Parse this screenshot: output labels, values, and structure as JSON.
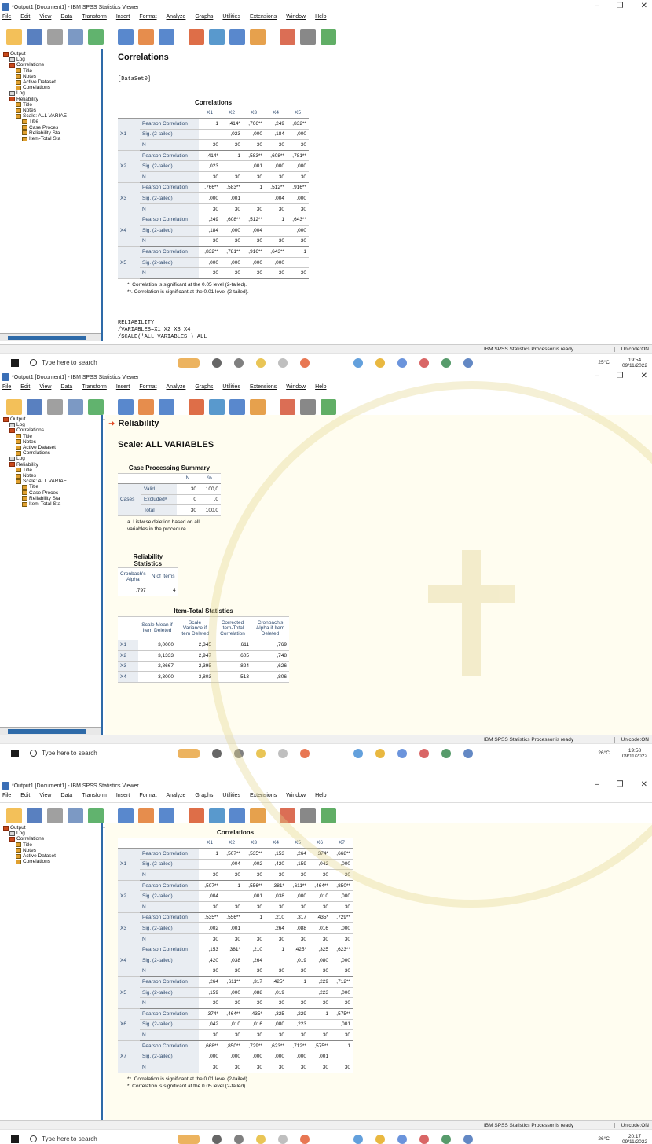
{
  "window": {
    "title": "*Output1 [Document1] - IBM SPSS Statistics Viewer"
  },
  "menu": [
    "File",
    "Edit",
    "View",
    "Data",
    "Transform",
    "Insert",
    "Format",
    "Analyze",
    "Graphs",
    "Utilities",
    "Extensions",
    "Window",
    "Help"
  ],
  "tree": [
    {
      "label": "Output",
      "level": 0
    },
    {
      "label": "Log",
      "level": 1
    },
    {
      "label": "Correlations",
      "level": 1
    },
    {
      "label": "Title",
      "level": 2
    },
    {
      "label": "Notes",
      "level": 2
    },
    {
      "label": "Active Dataset",
      "level": 2
    },
    {
      "label": "Correlations",
      "level": 2
    },
    {
      "label": "Log",
      "level": 1
    },
    {
      "label": "Reliability",
      "level": 1
    },
    {
      "label": "Title",
      "level": 2
    },
    {
      "label": "Notes",
      "level": 2
    },
    {
      "label": "Scale: ALL VARIAE",
      "level": 2
    },
    {
      "label": "Title",
      "level": 3
    },
    {
      "label": "Case Proces",
      "level": 3
    },
    {
      "label": "Reliability Sta",
      "level": 3
    },
    {
      "label": "Item-Total Sta",
      "level": 3
    }
  ],
  "tree3": [
    {
      "label": "Output",
      "level": 0
    },
    {
      "label": "Log",
      "level": 1
    },
    {
      "label": "Correlations",
      "level": 1
    },
    {
      "label": "Title",
      "level": 2
    },
    {
      "label": "Notes",
      "level": 2
    },
    {
      "label": "Active Dataset",
      "level": 2
    },
    {
      "label": "Correlations",
      "level": 2
    }
  ],
  "status": {
    "processor": "IBM SPSS Statistics Processor is ready",
    "unicode": "Unicode:ON"
  },
  "taskbar": {
    "search_placeholder": "Type here to search",
    "weather": "25°C",
    "weather2": "26°C",
    "times": [
      "19:54",
      "19:58",
      "20:17"
    ],
    "date": "09/11/2022"
  },
  "shot1": {
    "heading": "Correlations",
    "dataset": "[DataSet0]",
    "table_title": "Correlations",
    "cols": [
      "X1",
      "X2",
      "X3",
      "X4",
      "X5"
    ],
    "rows": [
      {
        "var": "X1",
        "pc": [
          "1",
          ",414*",
          ",766**",
          ",249",
          ",832**"
        ],
        "sig": [
          "",
          ",023",
          ",000",
          ",184",
          ",000"
        ],
        "n": [
          "30",
          "30",
          "30",
          "30",
          "30"
        ]
      },
      {
        "var": "X2",
        "pc": [
          ",414*",
          "1",
          ",583**",
          ",608**",
          ",781**"
        ],
        "sig": [
          ",023",
          "",
          ",001",
          ",000",
          ",000"
        ],
        "n": [
          "30",
          "30",
          "30",
          "30",
          "30"
        ]
      },
      {
        "var": "X3",
        "pc": [
          ",766**",
          ",583**",
          "1",
          ",512**",
          ",916**"
        ],
        "sig": [
          ",000",
          ",001",
          "",
          ",004",
          ",000"
        ],
        "n": [
          "30",
          "30",
          "30",
          "30",
          "30"
        ]
      },
      {
        "var": "X4",
        "pc": [
          ",249",
          ",608**",
          ",512**",
          "1",
          ",643**"
        ],
        "sig": [
          ",184",
          ",000",
          ",004",
          "",
          ",000"
        ],
        "n": [
          "30",
          "30",
          "30",
          "30",
          "30"
        ]
      },
      {
        "var": "X5",
        "pc": [
          ",832**",
          ",781**",
          ",916**",
          ",643**",
          "1"
        ],
        "sig": [
          ",000",
          ",000",
          ",000",
          ",000",
          ""
        ],
        "n": [
          "30",
          "30",
          "30",
          "30",
          "30"
        ]
      }
    ],
    "labels": {
      "pc": "Pearson Correlation",
      "sig": "Sig. (2-tailed)",
      "n": "N"
    },
    "foot": [
      "*. Correlation is significant at the 0.05 level (2-tailed).",
      "**. Correlation is significant at the 0.01 level (2-tailed)."
    ],
    "syntax": [
      "RELIABILITY",
      "  /VARIABLES=X1 X2 X3 X4",
      "  /SCALE('ALL VARIABLES') ALL"
    ]
  },
  "shot2": {
    "heading": "Reliability",
    "scale": "Scale: ALL VARIABLES",
    "cps": {
      "title": "Case Processing Summary",
      "cols": [
        "N",
        "%"
      ],
      "group": "Cases",
      "rows": [
        [
          "Valid",
          "30",
          "100,0"
        ],
        [
          "Excludedᵃ",
          "0",
          ",0"
        ],
        [
          "Total",
          "30",
          "100,0"
        ]
      ],
      "foot": [
        "a. Listwise deletion based on all",
        "variables in the procedure."
      ]
    },
    "rs": {
      "title": "Reliability Statistics",
      "cols": [
        "Cronbach's Alpha",
        "N of Items"
      ],
      "values": [
        ",797",
        "4"
      ]
    },
    "its": {
      "title": "Item-Total Statistics",
      "cols": [
        "Scale Mean if Item Deleted",
        "Scale Variance if Item Deleted",
        "Corrected Item-Total Correlation",
        "Cronbach's Alpha if Item Deleted"
      ],
      "rows": [
        [
          "X1",
          "3,0000",
          "2,345",
          ",611",
          ",769"
        ],
        [
          "X2",
          "3,1333",
          "2,947",
          ",605",
          ",748"
        ],
        [
          "X3",
          "2,8667",
          "2,395",
          ",824",
          ",626"
        ],
        [
          "X4",
          "3,3000",
          "3,803",
          ",513",
          ",806"
        ]
      ]
    }
  },
  "shot3": {
    "table_title": "Correlations",
    "cols": [
      "X1",
      "X2",
      "X3",
      "X4",
      "X5",
      "X6",
      "X7"
    ],
    "rows": [
      {
        "var": "X1",
        "pc": [
          "1",
          ",507**",
          ",535**",
          ",153",
          ",264",
          ",374*",
          ",668**"
        ],
        "sig": [
          "",
          ",004",
          ",002",
          ",420",
          ",159",
          ",042",
          ",000"
        ],
        "n": [
          "30",
          "30",
          "30",
          "30",
          "30",
          "30",
          "30"
        ]
      },
      {
        "var": "X2",
        "pc": [
          ",507**",
          "1",
          ",556**",
          ",381*",
          ",611**",
          ",464**",
          ",850**"
        ],
        "sig": [
          ",004",
          "",
          ",001",
          ",038",
          ",000",
          ",010",
          ",000"
        ],
        "n": [
          "30",
          "30",
          "30",
          "30",
          "30",
          "30",
          "30"
        ]
      },
      {
        "var": "X3",
        "pc": [
          ",535**",
          ",556**",
          "1",
          ",210",
          ",317",
          ",435*",
          ",729**"
        ],
        "sig": [
          ",002",
          ",001",
          "",
          ",264",
          ",088",
          ",016",
          ",000"
        ],
        "n": [
          "30",
          "30",
          "30",
          "30",
          "30",
          "30",
          "30"
        ]
      },
      {
        "var": "X4",
        "pc": [
          ",153",
          ",381*",
          ",210",
          "1",
          ",425*",
          ",325",
          ",623**"
        ],
        "sig": [
          ",420",
          ",038",
          ",264",
          "",
          ",019",
          ",080",
          ",000"
        ],
        "n": [
          "30",
          "30",
          "30",
          "30",
          "30",
          "30",
          "30"
        ]
      },
      {
        "var": "X5",
        "pc": [
          ",264",
          ",611**",
          ",317",
          ",425*",
          "1",
          ",229",
          ",712**"
        ],
        "sig": [
          ",159",
          ",000",
          ",088",
          ",019",
          "",
          ",223",
          ",000"
        ],
        "n": [
          "30",
          "30",
          "30",
          "30",
          "30",
          "30",
          "30"
        ]
      },
      {
        "var": "X6",
        "pc": [
          ",374*",
          ",464**",
          ",435*",
          ",325",
          ",229",
          "1",
          ",575**"
        ],
        "sig": [
          ",042",
          ",010",
          ",016",
          ",080",
          ",223",
          "",
          ",001"
        ],
        "n": [
          "30",
          "30",
          "30",
          "30",
          "30",
          "30",
          "30"
        ]
      },
      {
        "var": "X7",
        "pc": [
          ",668**",
          ",850**",
          ",729**",
          ",623**",
          ",712**",
          ",575**",
          "1"
        ],
        "sig": [
          ",000",
          ",000",
          ",000",
          ",000",
          ",000",
          ",001",
          ""
        ],
        "n": [
          "30",
          "30",
          "30",
          "30",
          "30",
          "30",
          "30"
        ]
      }
    ],
    "foot": [
      "**. Correlation is significant at the 0.01 level (2-tailed).",
      "*. Correlation is significant at the 0.05 level (2-tailed)."
    ]
  },
  "watermark": {
    "arc_letters": "UNIVERSITAS KATOLIK SOEGIJAPRANATA",
    "color": "#d9c97a"
  }
}
